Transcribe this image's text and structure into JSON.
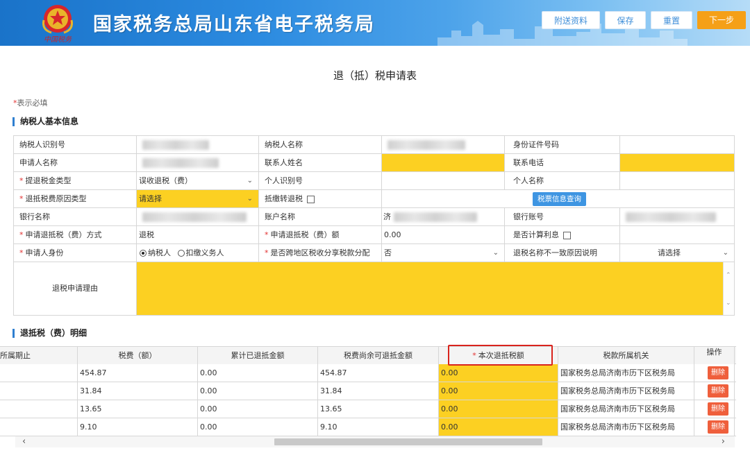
{
  "header": {
    "title": "国家税务总局山东省电子税务局",
    "buttons": {
      "attach": "附送资料",
      "save": "保存",
      "reset": "重置",
      "next": "下一步"
    },
    "logo_text": "中国税务"
  },
  "form": {
    "title": "退（抵）税申请表",
    "required_note": "表示必填",
    "required_star": "*"
  },
  "basic_info": {
    "section_title": "纳税人基本信息",
    "labels": {
      "taxpayer_id": "纳税人识别号",
      "taxpayer_name": "纳税人名称",
      "id_number": "身份证件号码",
      "applicant_name": "申请人名称",
      "contact_name": "联系人姓名",
      "contact_phone": "联系电话",
      "refund_type": "提退税金类型",
      "personal_id": "个人识别号",
      "personal_name": "个人名称",
      "refund_reason_type": "退抵税费原因类型",
      "offset_refund": "抵缴转退税",
      "bank_name": "银行名称",
      "account_name": "账户名称",
      "bank_account": "银行账号",
      "refund_method": "申请退抵税（费）方式",
      "refund_amount": "申请退抵税（费）额",
      "calc_interest": "是否计算利息",
      "applicant_identity": "申请人身份",
      "cross_region": "是否跨地区税收分享税款分配",
      "name_mismatch": "退税名称不一致原因说明",
      "reason": "退税申请理由"
    },
    "values": {
      "refund_type": "误收退税（费）",
      "refund_reason_type": "请选择",
      "query_button": "税票信息查询",
      "account_name_prefix": "济",
      "refund_method": "退税",
      "refund_amount": "0.00",
      "identity_taxpayer": "纳税人",
      "identity_withholder": "扣缴义务人",
      "cross_region": "否",
      "name_mismatch": "请选择"
    }
  },
  "detail": {
    "section_title": "退抵税（费）明细",
    "columns": [
      "所属期止",
      "税费（额）",
      "累计已退抵金额",
      "税费尚余可退抵金额",
      "本次退抵税额",
      "税款所属机关",
      "操作"
    ],
    "rows": [
      {
        "tax": "454.87",
        "refunded": "0.00",
        "remaining": "454.87",
        "current": "0.00",
        "authority": "国家税务总局济南市历下区税务局",
        "action": "删除"
      },
      {
        "tax": "31.84",
        "refunded": "0.00",
        "remaining": "31.84",
        "current": "0.00",
        "authority": "国家税务总局济南市历下区税务局",
        "action": "删除"
      },
      {
        "tax": "13.65",
        "refunded": "0.00",
        "remaining": "13.65",
        "current": "0.00",
        "authority": "国家税务总局济南市历下区税务局",
        "action": "删除"
      },
      {
        "tax": "9.10",
        "refunded": "0.00",
        "remaining": "9.10",
        "current": "0.00",
        "authority": "国家税务总局济南市历下区税务局",
        "action": "删除"
      }
    ]
  },
  "colors": {
    "header_blue": "#1a73c9",
    "required_yellow": "#fcd022",
    "next_orange": "#f5a017",
    "delete_red": "#ef5f3c",
    "highlight_red": "#d9231c"
  }
}
